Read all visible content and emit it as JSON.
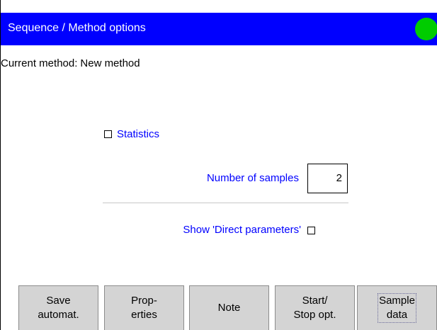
{
  "titlebar": {
    "title": "Sequence / Method options",
    "status_color": "#00cc00"
  },
  "current_method": {
    "label": "Current method:",
    "value": "New method"
  },
  "statistics": {
    "label": "Statistics",
    "checked": false
  },
  "number_of_samples": {
    "label": "Number of samples",
    "value": "2"
  },
  "direct_parameters": {
    "label": "Show 'Direct parameters'",
    "checked": false
  },
  "softkeys": {
    "save": "Save\nautomat.",
    "properties": "Prop-\nerties",
    "note": "Note",
    "start_stop": "Start/\nStop opt.",
    "sample_data": "Sample\ndata"
  },
  "colors": {
    "titlebar_background": "#0000ff",
    "label_text": "#0000ff",
    "softkey_background": "#d4d4d4"
  }
}
